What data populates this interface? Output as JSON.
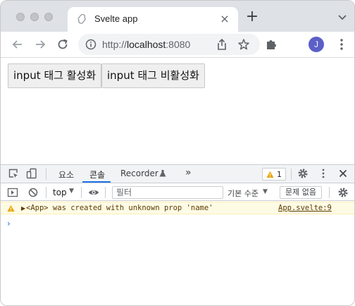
{
  "browser": {
    "tab_title": "Svelte app",
    "tab_close": "×",
    "new_tab": "+",
    "url_scheme": "http://",
    "url_host": "localhost",
    "url_port": ":8080",
    "profile_initial": "J"
  },
  "page": {
    "enable_button": "input 태그 활성화",
    "disable_button": "input 태그 비활성화"
  },
  "devtools": {
    "tabs": [
      "요소",
      "콘솔",
      "Recorder"
    ],
    "active_tab": "콘솔",
    "more_tabs": "»",
    "warning_count": "1",
    "context": "top",
    "filter_placeholder": "필터",
    "levels": "기본 수준",
    "issues": "문제 없음",
    "messages": [
      {
        "level": "warning",
        "text": "<App> was created with unknown prop 'name'",
        "source": "App.svelte:9"
      }
    ],
    "prompt": "›"
  },
  "colors": {
    "accent": "#1a73e8",
    "warning_bg": "#fefbe5",
    "warning_text": "#5c3c00",
    "avatar": "#5b5fc7"
  }
}
